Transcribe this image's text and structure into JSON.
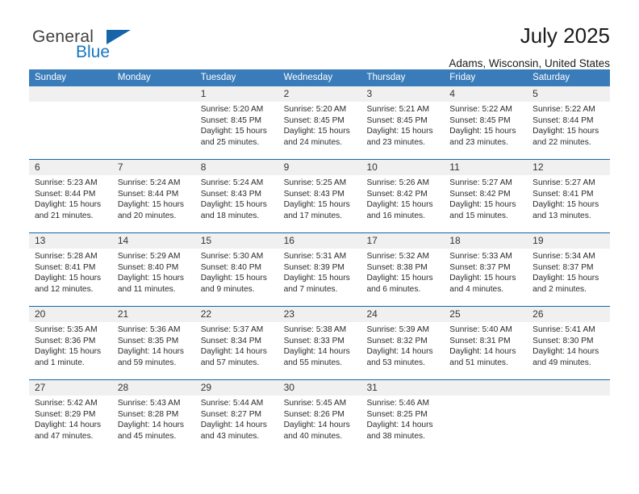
{
  "brand": {
    "name_top": "General",
    "name_bottom": "Blue",
    "accent": "#1677c0",
    "triangle_color": "#1565a8"
  },
  "header": {
    "title": "July 2025",
    "subtitle": "Adams, Wisconsin, United States"
  },
  "theme": {
    "header_band": "#3a7cb9",
    "row_rule": "#1565a8",
    "daynum_band": "#f0f0f0"
  },
  "weekdays": [
    "Sunday",
    "Monday",
    "Tuesday",
    "Wednesday",
    "Thursday",
    "Friday",
    "Saturday"
  ],
  "labels": {
    "sunrise": "Sunrise:",
    "sunset": "Sunset:",
    "daylight": "Daylight:"
  },
  "weeks": [
    [
      {
        "day": "",
        "empty": true
      },
      {
        "day": "",
        "empty": true
      },
      {
        "day": "1",
        "sunrise": "Sunrise: 5:20 AM",
        "sunset": "Sunset: 8:45 PM",
        "daylight1": "Daylight: 15 hours",
        "daylight2": "and 25 minutes."
      },
      {
        "day": "2",
        "sunrise": "Sunrise: 5:20 AM",
        "sunset": "Sunset: 8:45 PM",
        "daylight1": "Daylight: 15 hours",
        "daylight2": "and 24 minutes."
      },
      {
        "day": "3",
        "sunrise": "Sunrise: 5:21 AM",
        "sunset": "Sunset: 8:45 PM",
        "daylight1": "Daylight: 15 hours",
        "daylight2": "and 23 minutes."
      },
      {
        "day": "4",
        "sunrise": "Sunrise: 5:22 AM",
        "sunset": "Sunset: 8:45 PM",
        "daylight1": "Daylight: 15 hours",
        "daylight2": "and 23 minutes."
      },
      {
        "day": "5",
        "sunrise": "Sunrise: 5:22 AM",
        "sunset": "Sunset: 8:44 PM",
        "daylight1": "Daylight: 15 hours",
        "daylight2": "and 22 minutes."
      }
    ],
    [
      {
        "day": "6",
        "sunrise": "Sunrise: 5:23 AM",
        "sunset": "Sunset: 8:44 PM",
        "daylight1": "Daylight: 15 hours",
        "daylight2": "and 21 minutes."
      },
      {
        "day": "7",
        "sunrise": "Sunrise: 5:24 AM",
        "sunset": "Sunset: 8:44 PM",
        "daylight1": "Daylight: 15 hours",
        "daylight2": "and 20 minutes."
      },
      {
        "day": "8",
        "sunrise": "Sunrise: 5:24 AM",
        "sunset": "Sunset: 8:43 PM",
        "daylight1": "Daylight: 15 hours",
        "daylight2": "and 18 minutes."
      },
      {
        "day": "9",
        "sunrise": "Sunrise: 5:25 AM",
        "sunset": "Sunset: 8:43 PM",
        "daylight1": "Daylight: 15 hours",
        "daylight2": "and 17 minutes."
      },
      {
        "day": "10",
        "sunrise": "Sunrise: 5:26 AM",
        "sunset": "Sunset: 8:42 PM",
        "daylight1": "Daylight: 15 hours",
        "daylight2": "and 16 minutes."
      },
      {
        "day": "11",
        "sunrise": "Sunrise: 5:27 AM",
        "sunset": "Sunset: 8:42 PM",
        "daylight1": "Daylight: 15 hours",
        "daylight2": "and 15 minutes."
      },
      {
        "day": "12",
        "sunrise": "Sunrise: 5:27 AM",
        "sunset": "Sunset: 8:41 PM",
        "daylight1": "Daylight: 15 hours",
        "daylight2": "and 13 minutes."
      }
    ],
    [
      {
        "day": "13",
        "sunrise": "Sunrise: 5:28 AM",
        "sunset": "Sunset: 8:41 PM",
        "daylight1": "Daylight: 15 hours",
        "daylight2": "and 12 minutes."
      },
      {
        "day": "14",
        "sunrise": "Sunrise: 5:29 AM",
        "sunset": "Sunset: 8:40 PM",
        "daylight1": "Daylight: 15 hours",
        "daylight2": "and 11 minutes."
      },
      {
        "day": "15",
        "sunrise": "Sunrise: 5:30 AM",
        "sunset": "Sunset: 8:40 PM",
        "daylight1": "Daylight: 15 hours",
        "daylight2": "and 9 minutes."
      },
      {
        "day": "16",
        "sunrise": "Sunrise: 5:31 AM",
        "sunset": "Sunset: 8:39 PM",
        "daylight1": "Daylight: 15 hours",
        "daylight2": "and 7 minutes."
      },
      {
        "day": "17",
        "sunrise": "Sunrise: 5:32 AM",
        "sunset": "Sunset: 8:38 PM",
        "daylight1": "Daylight: 15 hours",
        "daylight2": "and 6 minutes."
      },
      {
        "day": "18",
        "sunrise": "Sunrise: 5:33 AM",
        "sunset": "Sunset: 8:37 PM",
        "daylight1": "Daylight: 15 hours",
        "daylight2": "and 4 minutes."
      },
      {
        "day": "19",
        "sunrise": "Sunrise: 5:34 AM",
        "sunset": "Sunset: 8:37 PM",
        "daylight1": "Daylight: 15 hours",
        "daylight2": "and 2 minutes."
      }
    ],
    [
      {
        "day": "20",
        "sunrise": "Sunrise: 5:35 AM",
        "sunset": "Sunset: 8:36 PM",
        "daylight1": "Daylight: 15 hours",
        "daylight2": "and 1 minute."
      },
      {
        "day": "21",
        "sunrise": "Sunrise: 5:36 AM",
        "sunset": "Sunset: 8:35 PM",
        "daylight1": "Daylight: 14 hours",
        "daylight2": "and 59 minutes."
      },
      {
        "day": "22",
        "sunrise": "Sunrise: 5:37 AM",
        "sunset": "Sunset: 8:34 PM",
        "daylight1": "Daylight: 14 hours",
        "daylight2": "and 57 minutes."
      },
      {
        "day": "23",
        "sunrise": "Sunrise: 5:38 AM",
        "sunset": "Sunset: 8:33 PM",
        "daylight1": "Daylight: 14 hours",
        "daylight2": "and 55 minutes."
      },
      {
        "day": "24",
        "sunrise": "Sunrise: 5:39 AM",
        "sunset": "Sunset: 8:32 PM",
        "daylight1": "Daylight: 14 hours",
        "daylight2": "and 53 minutes."
      },
      {
        "day": "25",
        "sunrise": "Sunrise: 5:40 AM",
        "sunset": "Sunset: 8:31 PM",
        "daylight1": "Daylight: 14 hours",
        "daylight2": "and 51 minutes."
      },
      {
        "day": "26",
        "sunrise": "Sunrise: 5:41 AM",
        "sunset": "Sunset: 8:30 PM",
        "daylight1": "Daylight: 14 hours",
        "daylight2": "and 49 minutes."
      }
    ],
    [
      {
        "day": "27",
        "sunrise": "Sunrise: 5:42 AM",
        "sunset": "Sunset: 8:29 PM",
        "daylight1": "Daylight: 14 hours",
        "daylight2": "and 47 minutes."
      },
      {
        "day": "28",
        "sunrise": "Sunrise: 5:43 AM",
        "sunset": "Sunset: 8:28 PM",
        "daylight1": "Daylight: 14 hours",
        "daylight2": "and 45 minutes."
      },
      {
        "day": "29",
        "sunrise": "Sunrise: 5:44 AM",
        "sunset": "Sunset: 8:27 PM",
        "daylight1": "Daylight: 14 hours",
        "daylight2": "and 43 minutes."
      },
      {
        "day": "30",
        "sunrise": "Sunrise: 5:45 AM",
        "sunset": "Sunset: 8:26 PM",
        "daylight1": "Daylight: 14 hours",
        "daylight2": "and 40 minutes."
      },
      {
        "day": "31",
        "sunrise": "Sunrise: 5:46 AM",
        "sunset": "Sunset: 8:25 PM",
        "daylight1": "Daylight: 14 hours",
        "daylight2": "and 38 minutes."
      },
      {
        "day": "",
        "empty": true
      },
      {
        "day": "",
        "empty": true
      }
    ]
  ]
}
